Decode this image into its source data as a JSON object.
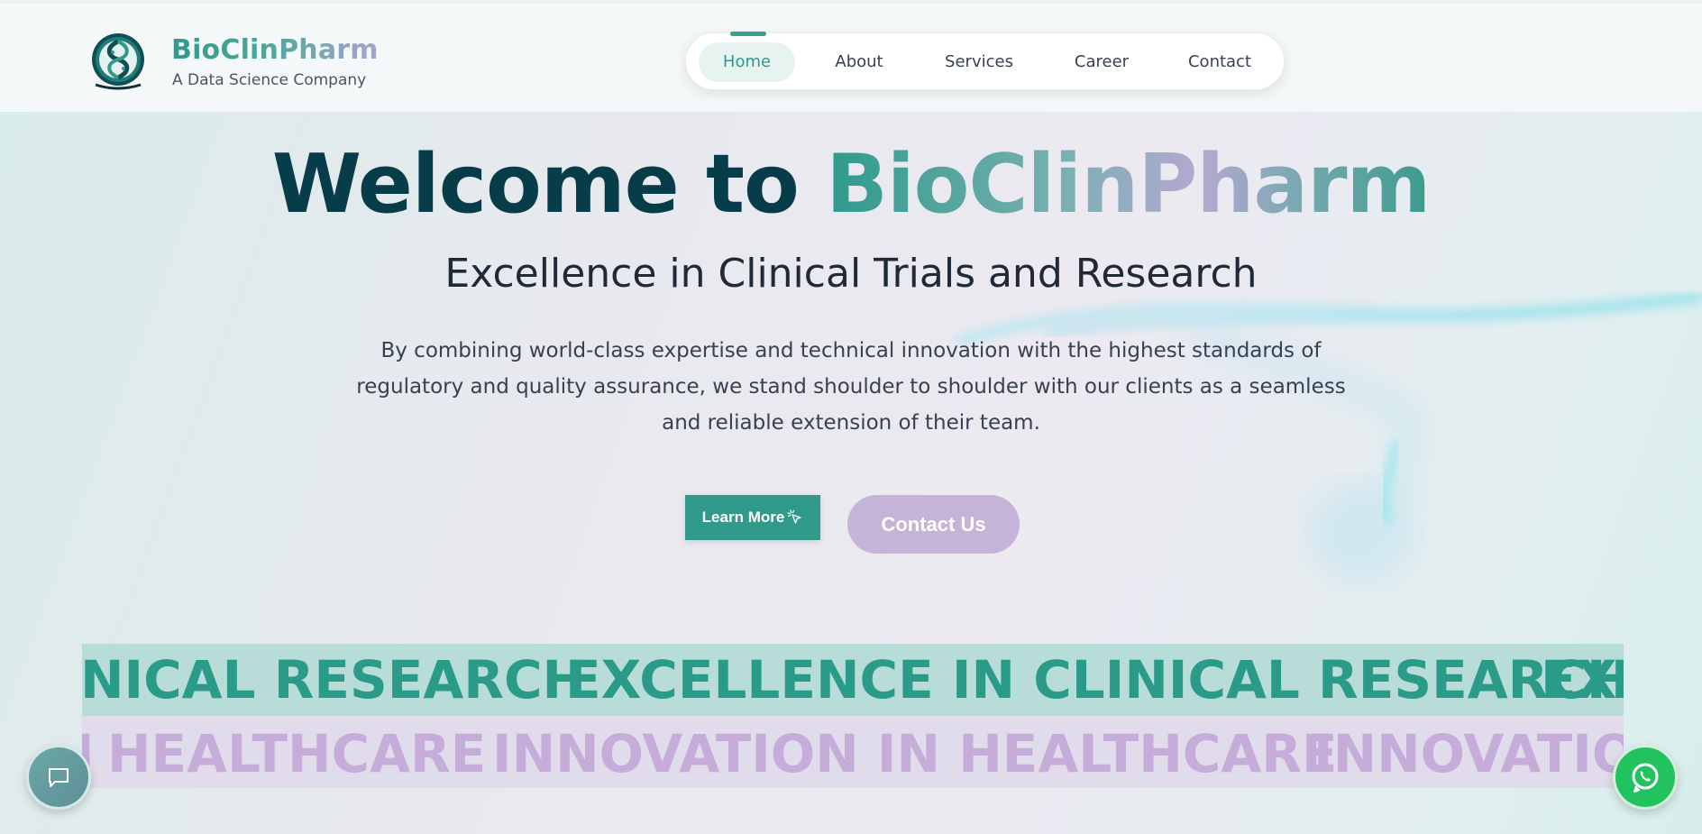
{
  "brand": {
    "name": "BioClinPharm",
    "tagline": "A Data Science Company",
    "logo_text": "BIO CLINPHARM"
  },
  "nav": {
    "items": [
      {
        "label": "Home",
        "active": true
      },
      {
        "label": "About",
        "active": false
      },
      {
        "label": "Services",
        "active": false
      },
      {
        "label": "Career",
        "active": false
      },
      {
        "label": "Contact",
        "active": false
      }
    ]
  },
  "hero": {
    "title_prefix": "Welcome to",
    "title_accent": "BioClinPharm",
    "subtitle": "Excellence in Clinical Trials and Research",
    "description": "By combining world-class expertise and technical innovation with the highest standards of regulatory and quality assurance, we stand shoulder to shoulder with our clients as a seamless and reliable extension of their team.",
    "learn_more_label": "Learn More",
    "contact_label": "Contact Us"
  },
  "marquee": {
    "row1": [
      "NICAL RESEARCH",
      "EXCELLENCE IN CLINICAL RESEARCH",
      "EXC"
    ],
    "row2": [
      "HEALTHCARE",
      "INNOVATION IN HEALTHCARE",
      "INNOVATIO"
    ]
  },
  "floating": {
    "chat_icon": "chat-bubble-icon",
    "whatsapp_icon": "whatsapp-icon"
  },
  "colors": {
    "primary": "#2f998a",
    "navy": "#063d48",
    "lavender": "#c5b4d8",
    "whatsapp": "#22c35e"
  }
}
